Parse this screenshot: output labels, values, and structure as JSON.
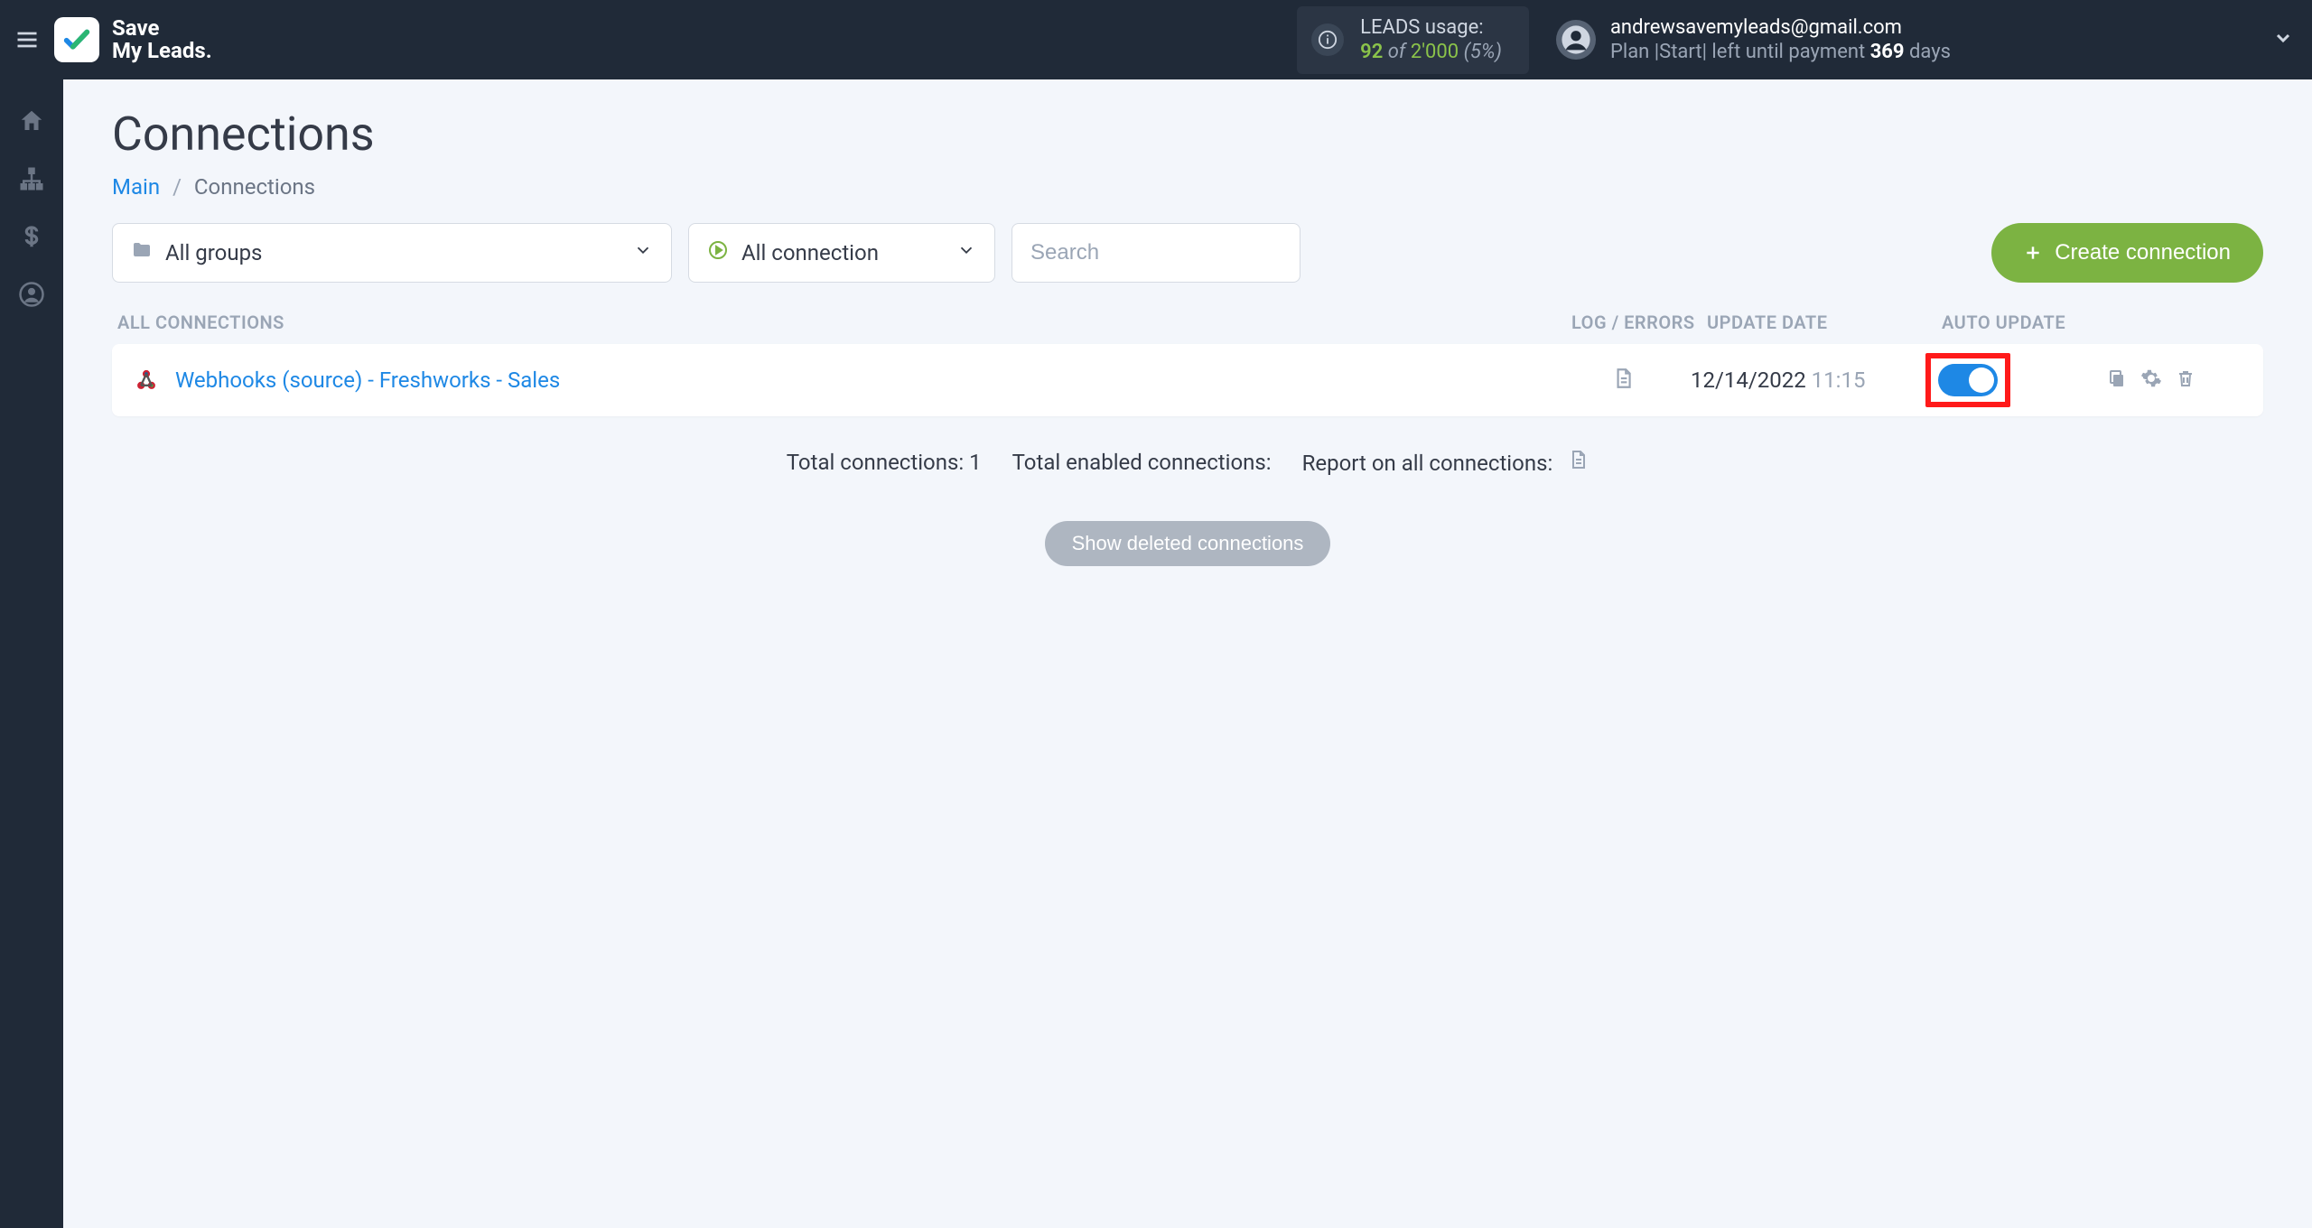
{
  "brand": {
    "line1": "Save",
    "line2": "My Leads."
  },
  "usage": {
    "label": "LEADS usage:",
    "current": "92",
    "of": "of",
    "total": "2'000",
    "pct": "(5%)"
  },
  "account": {
    "email": "andrewsavemyleads@gmail.com",
    "plan_prefix": "Plan |",
    "plan_name": "Start",
    "plan_mid": "| left until payment ",
    "days": "369",
    "plan_suffix": " days"
  },
  "page": {
    "title": "Connections",
    "breadcrumb_main": "Main",
    "breadcrumb_here": "Connections"
  },
  "filters": {
    "groups_label": "All groups",
    "status_label": "All connection",
    "search_placeholder": "Search",
    "create_label": "Create connection"
  },
  "cols": {
    "name": "All connections",
    "log": "Log / Errors",
    "date": "Update date",
    "auto": "Auto update"
  },
  "rows": [
    {
      "name": "Webhooks (source) - Freshworks - Sales",
      "date": "12/14/2022",
      "time": "11:15",
      "auto_update": true
    }
  ],
  "summary": {
    "total_label": "Total connections: ",
    "total_value": "1",
    "enabled_label": "Total enabled connections:",
    "report_label": "Report on all connections:"
  },
  "show_deleted_label": "Show deleted connections"
}
